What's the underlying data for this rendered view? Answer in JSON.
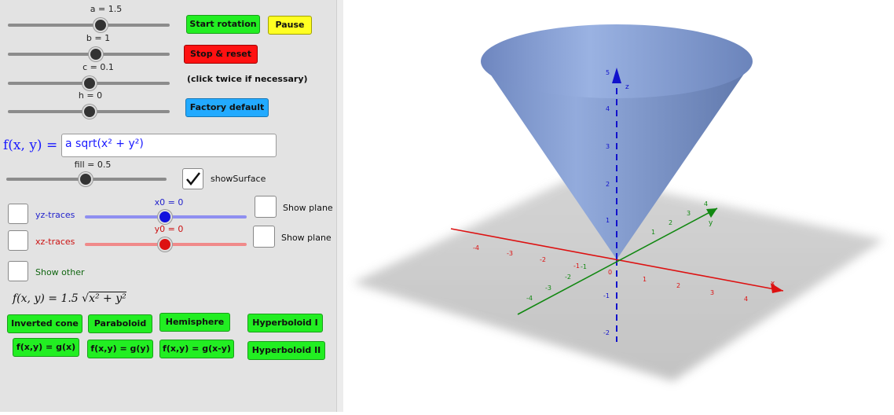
{
  "sliders": {
    "a_label": "a = 1.5",
    "b_label": "b = 1",
    "c_label": "c = 0.1",
    "h_label": "h = 0",
    "fill_label": "fill = 0.5",
    "x0_label": "x0 = 0",
    "y0_label": "y0 = 0",
    "a": 1.5,
    "b": 1,
    "c": 0.1,
    "h": 0,
    "fill": 0.5,
    "x0": 0,
    "y0": 0
  },
  "buttons": {
    "start_rotation": "Start rotation",
    "pause": "Pause",
    "stop_reset": "Stop & reset",
    "click_twice_note": "(click twice if necessary)",
    "factory_default": "Factory default"
  },
  "function_input": {
    "label": "f(x, y) =",
    "value": "a sqrt(x² + y²)"
  },
  "checkboxes": {
    "show_surface": "showSurface",
    "show_surface_checked": true,
    "yz_traces": "yz-traces",
    "xz_traces": "xz-traces",
    "show_plane_1": "Show plane",
    "show_plane_2": "Show plane",
    "show_other": "Show other"
  },
  "formula": {
    "lhs": "f(x, y) = 1.5",
    "radicand": "x² + y²"
  },
  "presets": {
    "inverted_cone": "Inverted cone",
    "paraboloid": "Paraboloid",
    "hemisphere": "Hemisphere",
    "hyperboloid_1": "Hyperboloid I",
    "fgx": "f(x,y) = g(x)",
    "fgy": "f(x,y) = g(y)",
    "fgxy": "f(x,y) = g(x-y)",
    "hyperboloid_2": "Hyperboloid II"
  },
  "axes": {
    "x_label": "x",
    "y_label": "y",
    "z_label": "z",
    "x_ticks": [
      "-4",
      "-3",
      "-2",
      "-1",
      "1",
      "2",
      "3",
      "4"
    ],
    "y_ticks": [
      "-4",
      "-3",
      "-2",
      "-1",
      "1",
      "2",
      "3",
      "4"
    ],
    "z_ticks": [
      "5",
      "4",
      "3",
      "2",
      "1",
      "-1",
      "-2"
    ],
    "origin_label": "0",
    "colors": {
      "x": "#dd1111",
      "y": "#118811",
      "z": "#1111cc",
      "surface": "#7f97c9"
    }
  }
}
